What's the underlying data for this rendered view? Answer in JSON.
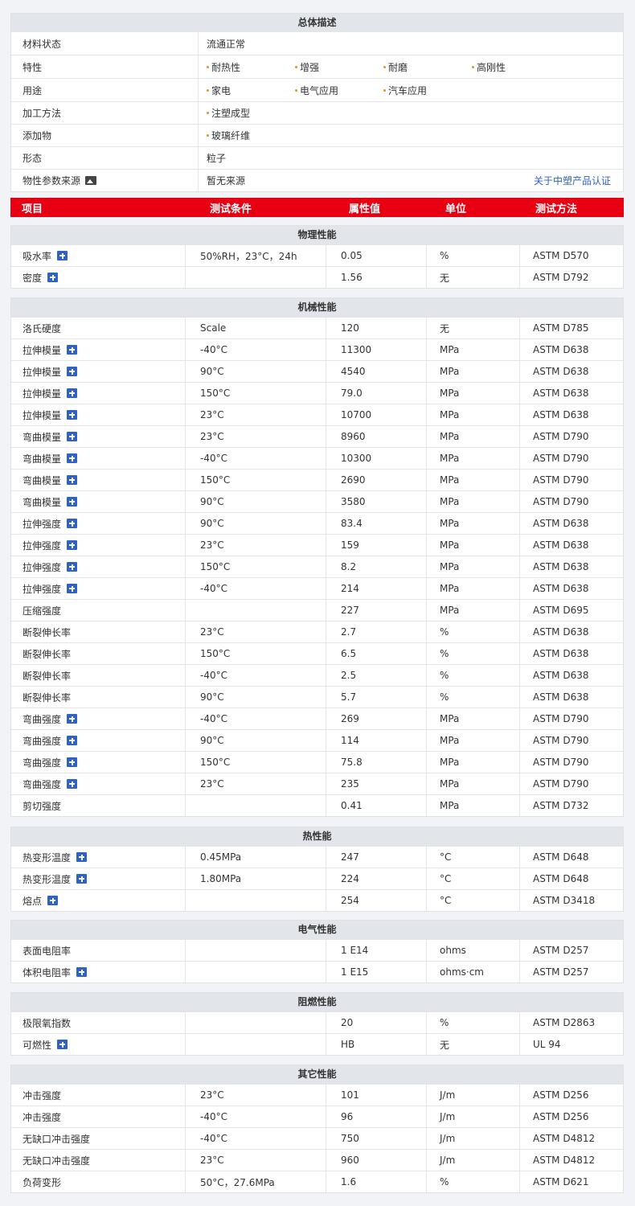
{
  "overview": {
    "title": "总体描述",
    "rows": [
      {
        "label": "材料状态",
        "value": "流通正常"
      },
      {
        "label": "特性",
        "tags": [
          "耐热性",
          "增强",
          "耐磨",
          "高刚性"
        ]
      },
      {
        "label": "用途",
        "tags": [
          "家电",
          "电气应用",
          "汽车应用"
        ]
      },
      {
        "label": "加工方法",
        "tags": [
          "注塑成型"
        ]
      },
      {
        "label": "添加物",
        "tags": [
          "玻璃纤维"
        ]
      },
      {
        "label": "形态",
        "value": "粒子"
      },
      {
        "label": "物性参数来源",
        "value": "暂无来源",
        "link": "关于中塑产品认证"
      }
    ]
  },
  "table_header": [
    "项目",
    "测试条件",
    "属性值",
    "单位",
    "测试方法"
  ],
  "sections": [
    {
      "title": "物理性能",
      "rows": [
        {
          "item": "吸水率",
          "plus": true,
          "cond": "50%RH，23°C，24h",
          "val": "0.05",
          "unit": "%",
          "method": "ASTM D570"
        },
        {
          "item": "密度",
          "plus": true,
          "cond": "",
          "val": "1.56",
          "unit": "无",
          "method": "ASTM D792"
        }
      ]
    },
    {
      "title": "机械性能",
      "rows": [
        {
          "item": "洛氏硬度",
          "plus": false,
          "cond": "Scale",
          "val": "120",
          "unit": "无",
          "method": "ASTM D785"
        },
        {
          "item": "拉伸模量",
          "plus": true,
          "cond": "-40°C",
          "val": "11300",
          "unit": "MPa",
          "method": "ASTM D638"
        },
        {
          "item": "拉伸模量",
          "plus": true,
          "cond": "90°C",
          "val": "4540",
          "unit": "MPa",
          "method": "ASTM D638"
        },
        {
          "item": "拉伸模量",
          "plus": true,
          "cond": "150°C",
          "val": "79.0",
          "unit": "MPa",
          "method": "ASTM D638"
        },
        {
          "item": "拉伸模量",
          "plus": true,
          "cond": "23°C",
          "val": "10700",
          "unit": "MPa",
          "method": "ASTM D638"
        },
        {
          "item": "弯曲模量",
          "plus": true,
          "cond": "23°C",
          "val": "8960",
          "unit": "MPa",
          "method": "ASTM D790"
        },
        {
          "item": "弯曲模量",
          "plus": true,
          "cond": "-40°C",
          "val": "10300",
          "unit": "MPa",
          "method": "ASTM D790"
        },
        {
          "item": "弯曲模量",
          "plus": true,
          "cond": "150°C",
          "val": "2690",
          "unit": "MPa",
          "method": "ASTM D790"
        },
        {
          "item": "弯曲模量",
          "plus": true,
          "cond": "90°C",
          "val": "3580",
          "unit": "MPa",
          "method": "ASTM D790"
        },
        {
          "item": "拉伸强度",
          "plus": true,
          "cond": "90°C",
          "val": "83.4",
          "unit": "MPa",
          "method": "ASTM D638"
        },
        {
          "item": "拉伸强度",
          "plus": true,
          "cond": "23°C",
          "val": "159",
          "unit": "MPa",
          "method": "ASTM D638"
        },
        {
          "item": "拉伸强度",
          "plus": true,
          "cond": "150°C",
          "val": "8.2",
          "unit": "MPa",
          "method": "ASTM D638"
        },
        {
          "item": "拉伸强度",
          "plus": true,
          "cond": "-40°C",
          "val": "214",
          "unit": "MPa",
          "method": "ASTM D638"
        },
        {
          "item": "压缩强度",
          "plus": false,
          "cond": "",
          "val": "227",
          "unit": "MPa",
          "method": "ASTM D695"
        },
        {
          "item": "断裂伸长率",
          "plus": false,
          "cond": "23°C",
          "val": "2.7",
          "unit": "%",
          "method": "ASTM D638"
        },
        {
          "item": "断裂伸长率",
          "plus": false,
          "cond": "150°C",
          "val": "6.5",
          "unit": "%",
          "method": "ASTM D638"
        },
        {
          "item": "断裂伸长率",
          "plus": false,
          "cond": "-40°C",
          "val": "2.5",
          "unit": "%",
          "method": "ASTM D638"
        },
        {
          "item": "断裂伸长率",
          "plus": false,
          "cond": "90°C",
          "val": "5.7",
          "unit": "%",
          "method": "ASTM D638"
        },
        {
          "item": "弯曲强度",
          "plus": true,
          "cond": "-40°C",
          "val": "269",
          "unit": "MPa",
          "method": "ASTM D790"
        },
        {
          "item": "弯曲强度",
          "plus": true,
          "cond": "90°C",
          "val": "114",
          "unit": "MPa",
          "method": "ASTM D790"
        },
        {
          "item": "弯曲强度",
          "plus": true,
          "cond": "150°C",
          "val": "75.8",
          "unit": "MPa",
          "method": "ASTM D790"
        },
        {
          "item": "弯曲强度",
          "plus": true,
          "cond": "23°C",
          "val": "235",
          "unit": "MPa",
          "method": "ASTM D790"
        },
        {
          "item": "剪切强度",
          "plus": false,
          "cond": "",
          "val": "0.41",
          "unit": "MPa",
          "method": "ASTM D732"
        }
      ]
    },
    {
      "title": "热性能",
      "rows": [
        {
          "item": "热变形温度",
          "plus": true,
          "cond": "0.45MPa",
          "val": "247",
          "unit": "°C",
          "method": "ASTM D648"
        },
        {
          "item": "热变形温度",
          "plus": true,
          "cond": "1.80MPa",
          "val": "224",
          "unit": "°C",
          "method": "ASTM D648"
        },
        {
          "item": "熔点",
          "plus": true,
          "cond": "",
          "val": "254",
          "unit": "°C",
          "method": "ASTM D3418"
        }
      ]
    },
    {
      "title": "电气性能",
      "rows": [
        {
          "item": "表面电阻率",
          "plus": false,
          "cond": "",
          "val": "1 E14",
          "unit": "ohms",
          "method": "ASTM D257"
        },
        {
          "item": "体积电阻率",
          "plus": true,
          "cond": "",
          "val": "1 E15",
          "unit": "ohms·cm",
          "method": "ASTM D257"
        }
      ]
    },
    {
      "title": "阻燃性能",
      "rows": [
        {
          "item": "极限氧指数",
          "plus": false,
          "cond": "",
          "val": "20",
          "unit": "%",
          "method": "ASTM D2863"
        },
        {
          "item": "可燃性",
          "plus": true,
          "cond": "",
          "val": "HB",
          "unit": "无",
          "method": "UL 94"
        }
      ]
    },
    {
      "title": "其它性能",
      "rows": [
        {
          "item": "冲击强度",
          "plus": false,
          "cond": "23°C",
          "val": "101",
          "unit": "J/m",
          "method": "ASTM D256"
        },
        {
          "item": "冲击强度",
          "plus": false,
          "cond": "-40°C",
          "val": "96",
          "unit": "J/m",
          "method": "ASTM D256"
        },
        {
          "item": "无缺口冲击强度",
          "plus": false,
          "cond": "-40°C",
          "val": "750",
          "unit": "J/m",
          "method": "ASTM D4812"
        },
        {
          "item": "无缺口冲击强度",
          "plus": false,
          "cond": "23°C",
          "val": "960",
          "unit": "J/m",
          "method": "ASTM D4812"
        },
        {
          "item": "负荷变形",
          "plus": false,
          "cond": "50°C，27.6MPa",
          "val": "1.6",
          "unit": "%",
          "method": "ASTM D621"
        }
      ]
    }
  ]
}
